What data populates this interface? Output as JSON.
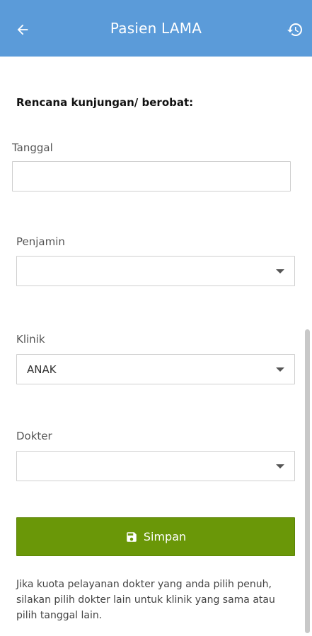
{
  "header": {
    "title": "Pasien LAMA",
    "back_icon": "arrow-left-icon",
    "history_icon": "history-icon",
    "bg_color": "#5b9bd9"
  },
  "form": {
    "section_title": "Rencana kunjungan/ berobat:",
    "tanggal": {
      "label": "Tanggal",
      "value": ""
    },
    "penjamin": {
      "label": "Penjamin",
      "value": ""
    },
    "klinik": {
      "label": "Klinik",
      "value": "ANAK"
    },
    "dokter": {
      "label": "Dokter",
      "value": ""
    }
  },
  "save_button": {
    "label": "Simpan",
    "icon": "save-icon",
    "color": "#6a9708"
  },
  "note": "Jika kuota pelayanan dokter yang anda pilih penuh, silakan pilih dokter lain untuk klinik yang sama atau pilih tanggal lain."
}
